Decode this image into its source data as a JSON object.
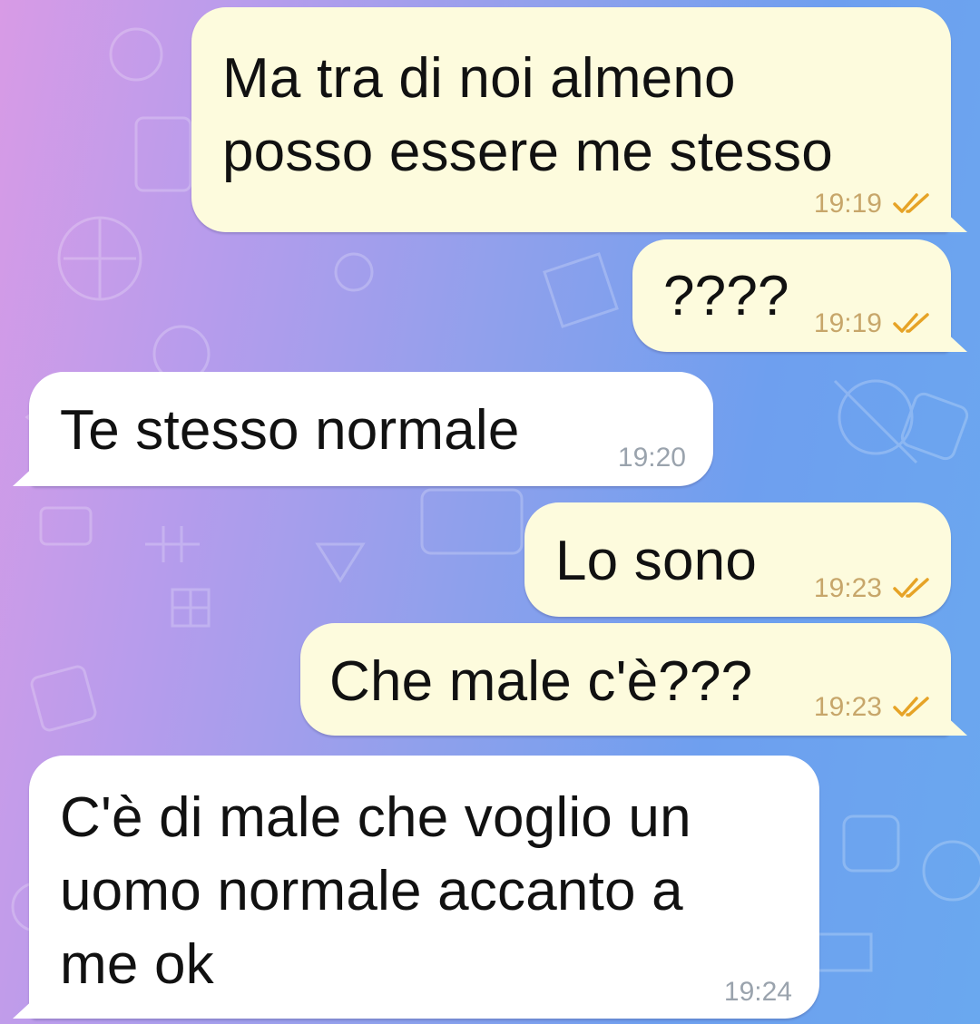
{
  "colors": {
    "outgoing_bubble": "#fdfbdd",
    "incoming_bubble": "#ffffff",
    "outgoing_time": "#c7a66a",
    "incoming_time": "#9aa3ad",
    "read_ticks": "#e6a326"
  },
  "messages": [
    {
      "direction": "outgoing",
      "text": "Ma tra di noi almeno\nposso essere me stesso",
      "time": "19:19",
      "status_icon": "double-check-read-icon"
    },
    {
      "direction": "outgoing",
      "text": "????",
      "time": "19:19",
      "status_icon": "double-check-read-icon"
    },
    {
      "direction": "incoming",
      "text": "Te stesso normale",
      "time": "19:20"
    },
    {
      "direction": "outgoing",
      "text": "Lo sono",
      "time": "19:23",
      "status_icon": "double-check-read-icon"
    },
    {
      "direction": "outgoing",
      "text": "Che male c'è???",
      "time": "19:23",
      "status_icon": "double-check-read-icon"
    },
    {
      "direction": "incoming",
      "text": "C'è di male che voglio un\nuomo normale accanto a\nme ok",
      "time": "19:24"
    }
  ]
}
